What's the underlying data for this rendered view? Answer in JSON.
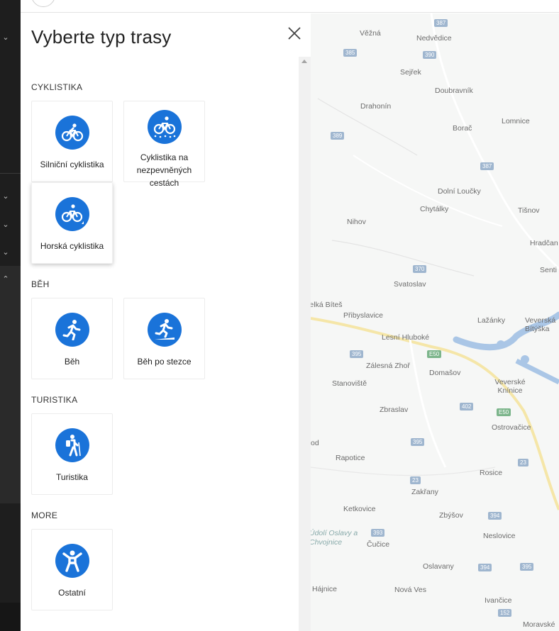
{
  "panel": {
    "title": "Vyberte typ trasy",
    "sections": [
      {
        "heading": "CYKLISTIKA",
        "items": [
          "Silniční cyklistika",
          "Cyklistika na nezpevněných cestách",
          "Horská cyklistika"
        ]
      },
      {
        "heading": "BĚH",
        "items": [
          "Běh",
          "Běh po stezce"
        ]
      },
      {
        "heading": "TURISTIKA",
        "items": [
          "Turistika"
        ]
      },
      {
        "heading": "MORE",
        "items": [
          "Ostatní"
        ]
      }
    ]
  },
  "map": {
    "places": [
      "Věžná",
      "Nedvědice",
      "Sejřek",
      "Doubravník",
      "Drahonín",
      "Borač",
      "Lomnice",
      "Dolní Loučky",
      "Chytálky",
      "Tišnov",
      "Nihov",
      "Hradčan",
      "Senti",
      "Svatoslav",
      "Velká Bíteš",
      "Přibyslavice",
      "Lažánky",
      "Veverská Bítýška",
      "Lesní Hluboké",
      "Zálesná Zhoř",
      "Domašov",
      "Veverské Knínice",
      "Stanoviště",
      "Zbraslav",
      "Ostrovačice",
      "Rapotice",
      "Rosice",
      "Zakřany",
      "Ketkovice",
      "Zbýšov",
      "Údolí Oslavy a Chvojnice",
      "Čučice",
      "Neslovice",
      "Oslavany",
      "Nová Ves",
      "Ivančice",
      "Moravské",
      "Hájnice",
      "od"
    ],
    "roads": [
      "387",
      "385",
      "390",
      "389",
      "387",
      "370",
      "395",
      "E50",
      "402",
      "E50",
      "395",
      "23",
      "23",
      "394",
      "393",
      "394",
      "395",
      "152"
    ],
    "colors": {
      "water": "#aac6e6",
      "road": "#f5e6a8"
    }
  },
  "colors": {
    "accent": "#1a73d9",
    "rail": "#1e1e1e"
  }
}
